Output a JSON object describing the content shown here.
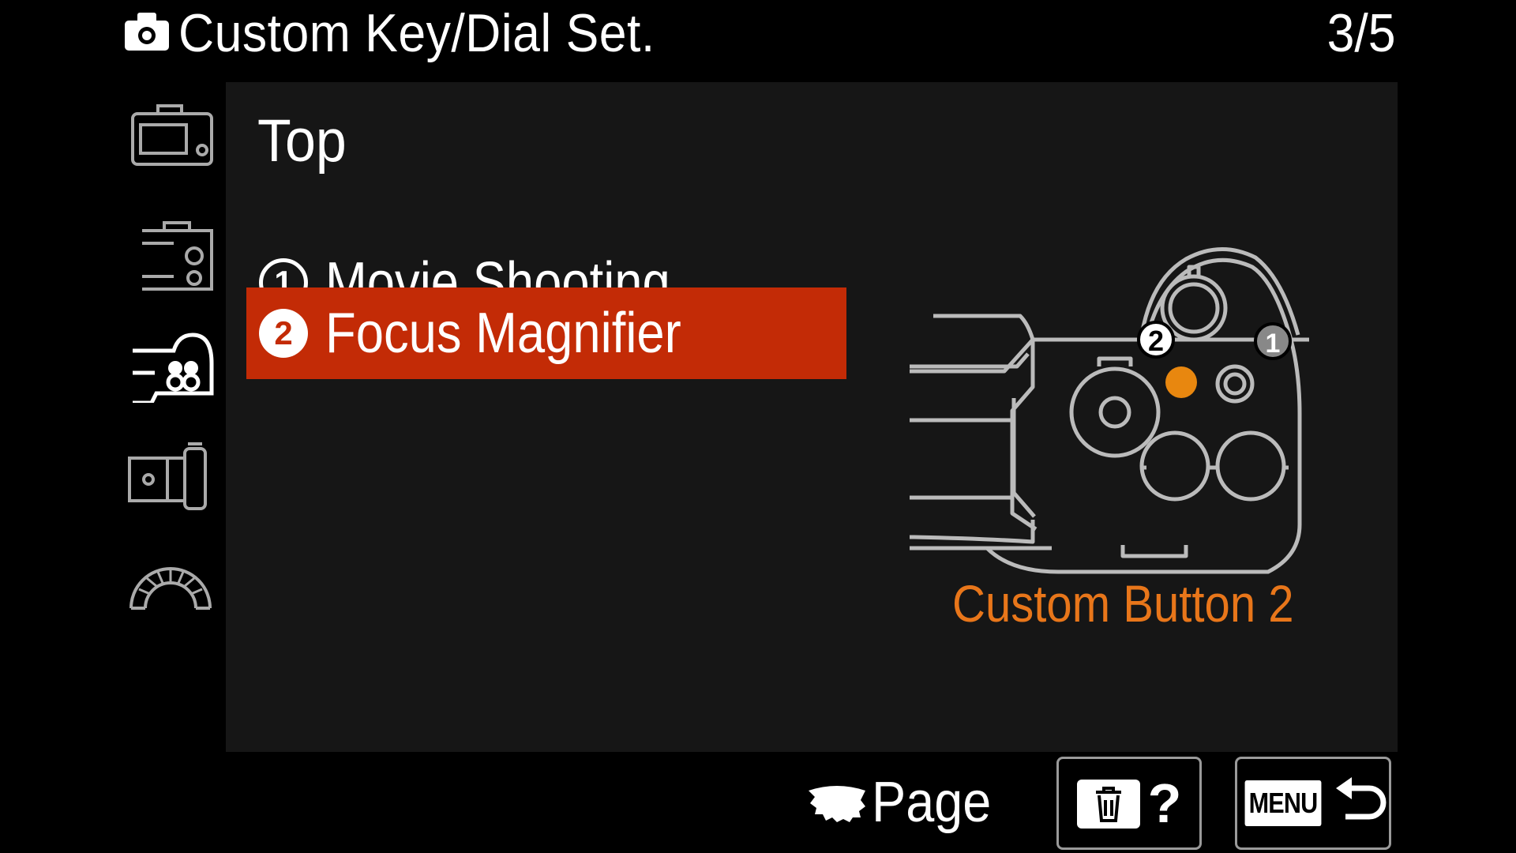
{
  "header": {
    "icon": "camera-icon",
    "title": "Custom Key/Dial Set.",
    "page_counter": "3/5"
  },
  "sidebar": {
    "tabs": [
      {
        "icon": "camera-body-icon",
        "selected": false
      },
      {
        "icon": "camera-settings-icon",
        "selected": false
      },
      {
        "icon": "custom-button-icon",
        "selected": true
      },
      {
        "icon": "camera-side-icon",
        "selected": false
      },
      {
        "icon": "dial-meter-icon",
        "selected": false
      }
    ]
  },
  "main": {
    "section_title": "Top",
    "items": [
      {
        "number": "1",
        "label": "Movie Shooting",
        "selected": false
      },
      {
        "number": "2",
        "label": "Focus Magnifier",
        "selected": true
      }
    ],
    "diagram": {
      "icon": "camera-top-view-icon",
      "badge_1": "1",
      "badge_2": "2",
      "highlight_color": "#e8870f",
      "caption": "Custom Button 2"
    }
  },
  "footer": {
    "page_hint_icon": "control-wheel-icon",
    "page_hint_label": "Page",
    "help_button_icon": "trash-icon",
    "help_mark": "?",
    "back_button_key": "MENU",
    "back_button_icon": "return-arrow-icon"
  },
  "colors": {
    "selection": "#c32b06",
    "caption": "#e8761a",
    "panel": "#161616",
    "background": "#000000"
  }
}
